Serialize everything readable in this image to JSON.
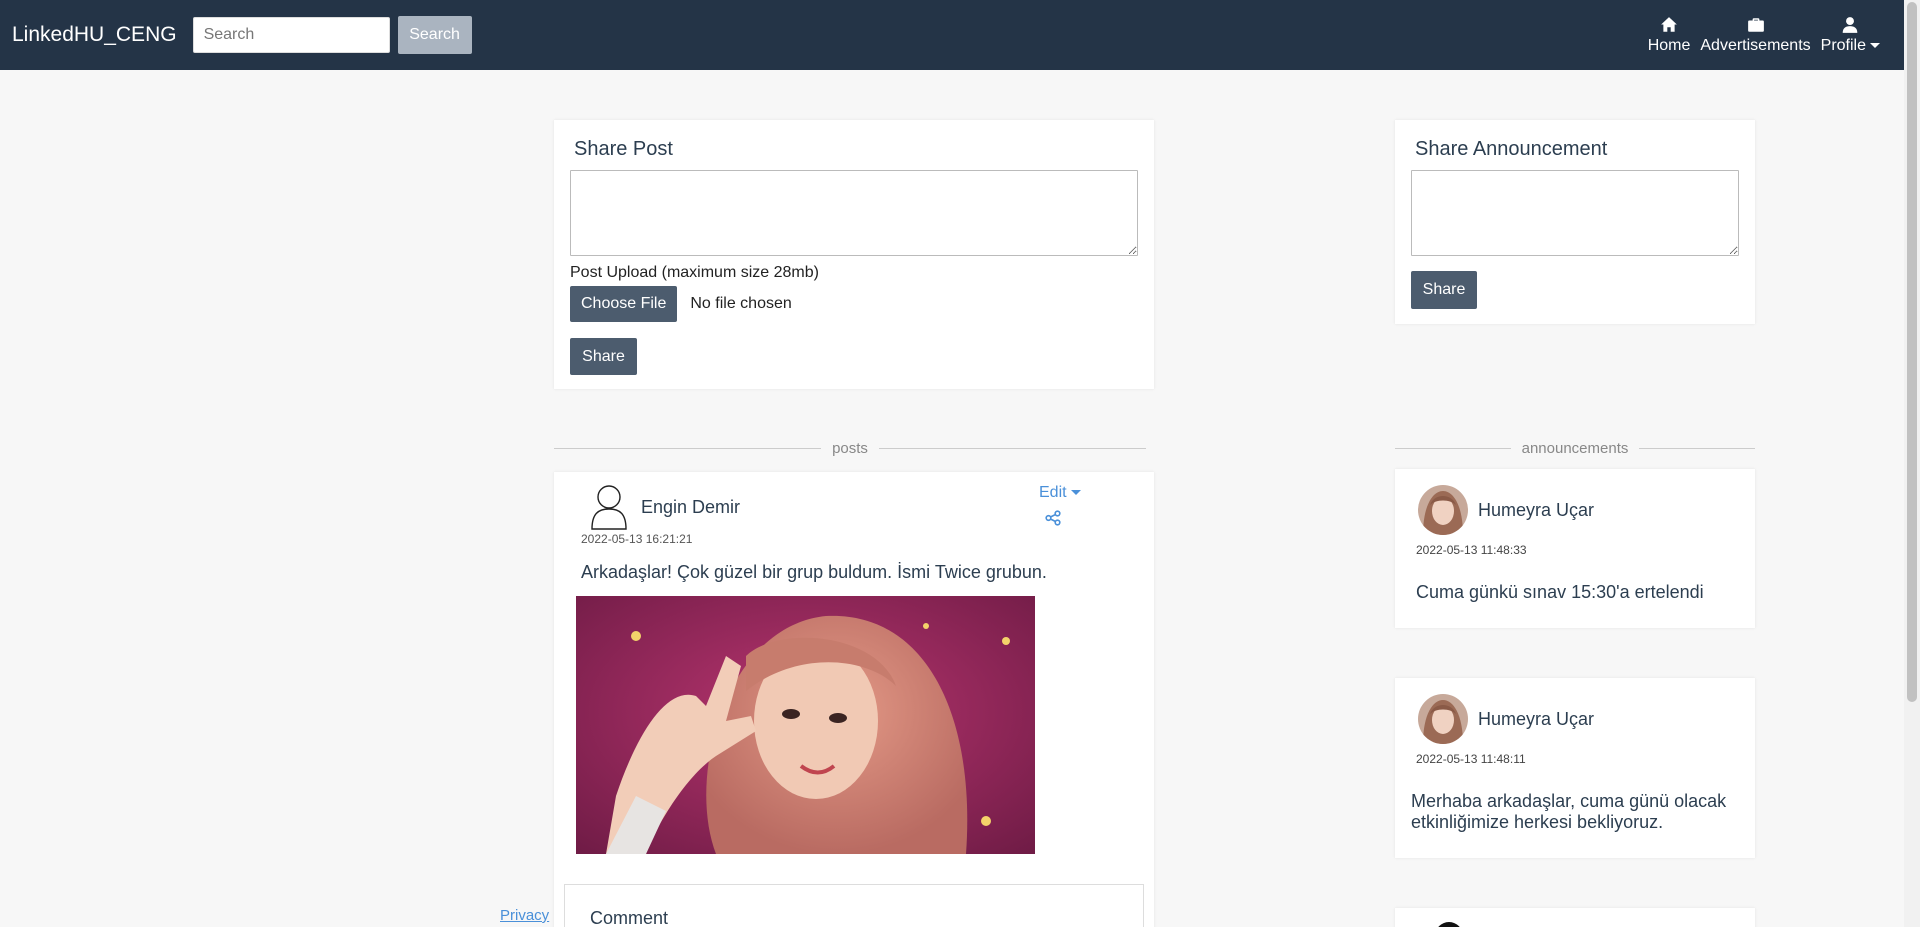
{
  "navbar": {
    "brand": "LinkedHU_CENG",
    "search_placeholder": "Search",
    "search_button": "Search",
    "items": [
      {
        "label": "Home",
        "icon": "home-icon"
      },
      {
        "label": "Advertisements",
        "icon": "briefcase-icon"
      },
      {
        "label": "Profile",
        "icon": "user-icon"
      }
    ]
  },
  "share_post": {
    "title": "Share Post",
    "upload_label": "Post Upload (maximum size 28mb)",
    "choose_file": "Choose File",
    "no_file": "No file chosen",
    "share_button": "Share"
  },
  "share_announcement": {
    "title": "Share Announcement",
    "share_button": "Share"
  },
  "dividers": {
    "posts": "posts",
    "announcements": "announcements"
  },
  "post": {
    "author": "Engin Demir",
    "timestamp": "2022-05-13 16:21:21",
    "edit": "Edit",
    "text": "Arkadaşlar! Çok güzel bir grup buldum. İsmi Twice grubun.",
    "comment_label": "Comment"
  },
  "announcements": [
    {
      "author": "Humeyra Uçar",
      "timestamp": "2022-05-13 11:48:33",
      "text": "Cuma günkü sınav 15:30'a ertelendi"
    },
    {
      "author": "Humeyra Uçar",
      "timestamp": "2022-05-13 11:48:11",
      "text": "Merhaba arkadaşlar, cuma günü olacak etkinliğimize herkesi bekliyoruz."
    }
  ],
  "footer": {
    "privacy": "Privacy"
  },
  "colors": {
    "navbar": "#243447",
    "button_dark": "#4c5c6e",
    "link": "#4a90d9",
    "background": "#f7f7f7"
  }
}
